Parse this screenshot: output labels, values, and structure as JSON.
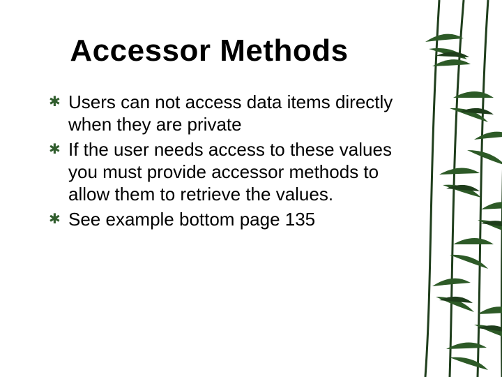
{
  "slide": {
    "title": "Accessor Methods",
    "bullets": [
      "Users can not access data items directly when they are private",
      "If the user needs access to these values you must provide accessor methods to allow them to retrieve the values.",
      "See example bottom page 135"
    ],
    "bullet_glyph": "✱",
    "accent_color": "#315e2e"
  }
}
